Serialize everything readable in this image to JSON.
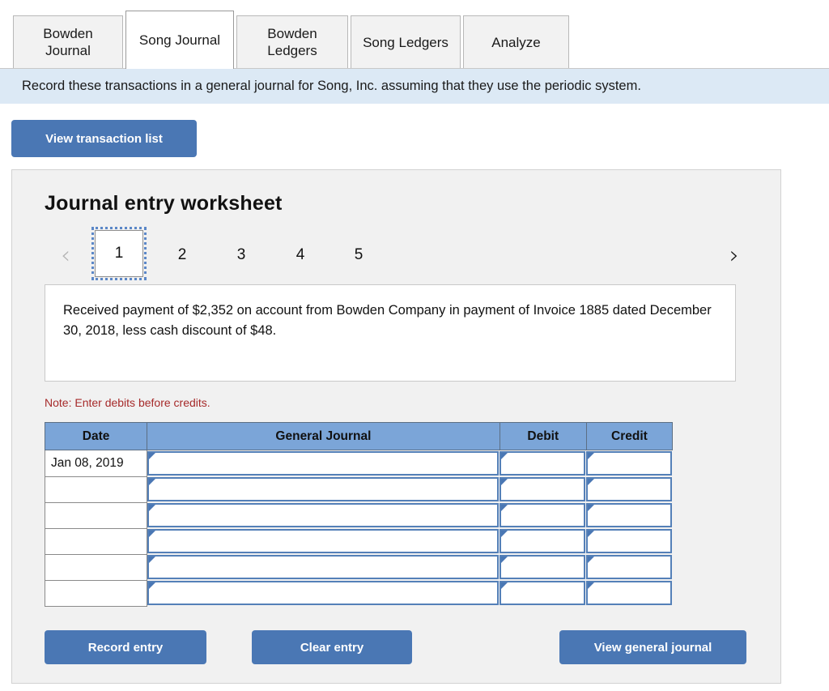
{
  "tabs": [
    {
      "label": "Bowden\nJournal",
      "active": false
    },
    {
      "label": "Song Journal",
      "active": true
    },
    {
      "label": "Bowden\nLedgers",
      "active": false
    },
    {
      "label": "Song Ledgers",
      "active": false
    },
    {
      "label": "Analyze",
      "active": false
    }
  ],
  "banner": {
    "text": "Record these transactions in a general journal for Song, Inc. assuming that they use the periodic system."
  },
  "toolbar": {
    "view_transaction_list_label": "View transaction list"
  },
  "worksheet": {
    "title": "Journal entry worksheet",
    "pager": {
      "prev_icon": "‹",
      "next_icon": "›",
      "pages": [
        "1",
        "2",
        "3",
        "4",
        "5"
      ],
      "active_page": "1"
    },
    "description": "Received payment of $2,352 on account from Bowden Company in payment of Invoice 1885 dated December 30, 2018, less cash discount of $48.",
    "note": "Note: Enter debits before credits.",
    "table": {
      "headers": [
        "Date",
        "General Journal",
        "Debit",
        "Credit"
      ],
      "rows": [
        {
          "date": "Jan 08, 2019",
          "general_journal": "",
          "debit": "",
          "credit": ""
        },
        {
          "date": "",
          "general_journal": "",
          "debit": "",
          "credit": ""
        },
        {
          "date": "",
          "general_journal": "",
          "debit": "",
          "credit": ""
        },
        {
          "date": "",
          "general_journal": "",
          "debit": "",
          "credit": ""
        },
        {
          "date": "",
          "general_journal": "",
          "debit": "",
          "credit": ""
        },
        {
          "date": "",
          "general_journal": "",
          "debit": "",
          "credit": ""
        }
      ]
    },
    "actions": {
      "record_entry_label": "Record entry",
      "clear_entry_label": "Clear entry",
      "view_general_journal_label": "View general journal"
    }
  },
  "colors": {
    "button_blue": "#4a77b4",
    "header_blue": "#7ba5d8",
    "banner_blue": "#dce9f5",
    "note_red": "#a62a2a",
    "panel_gray": "#f1f1f1",
    "field_border_blue": "#5480b8"
  }
}
